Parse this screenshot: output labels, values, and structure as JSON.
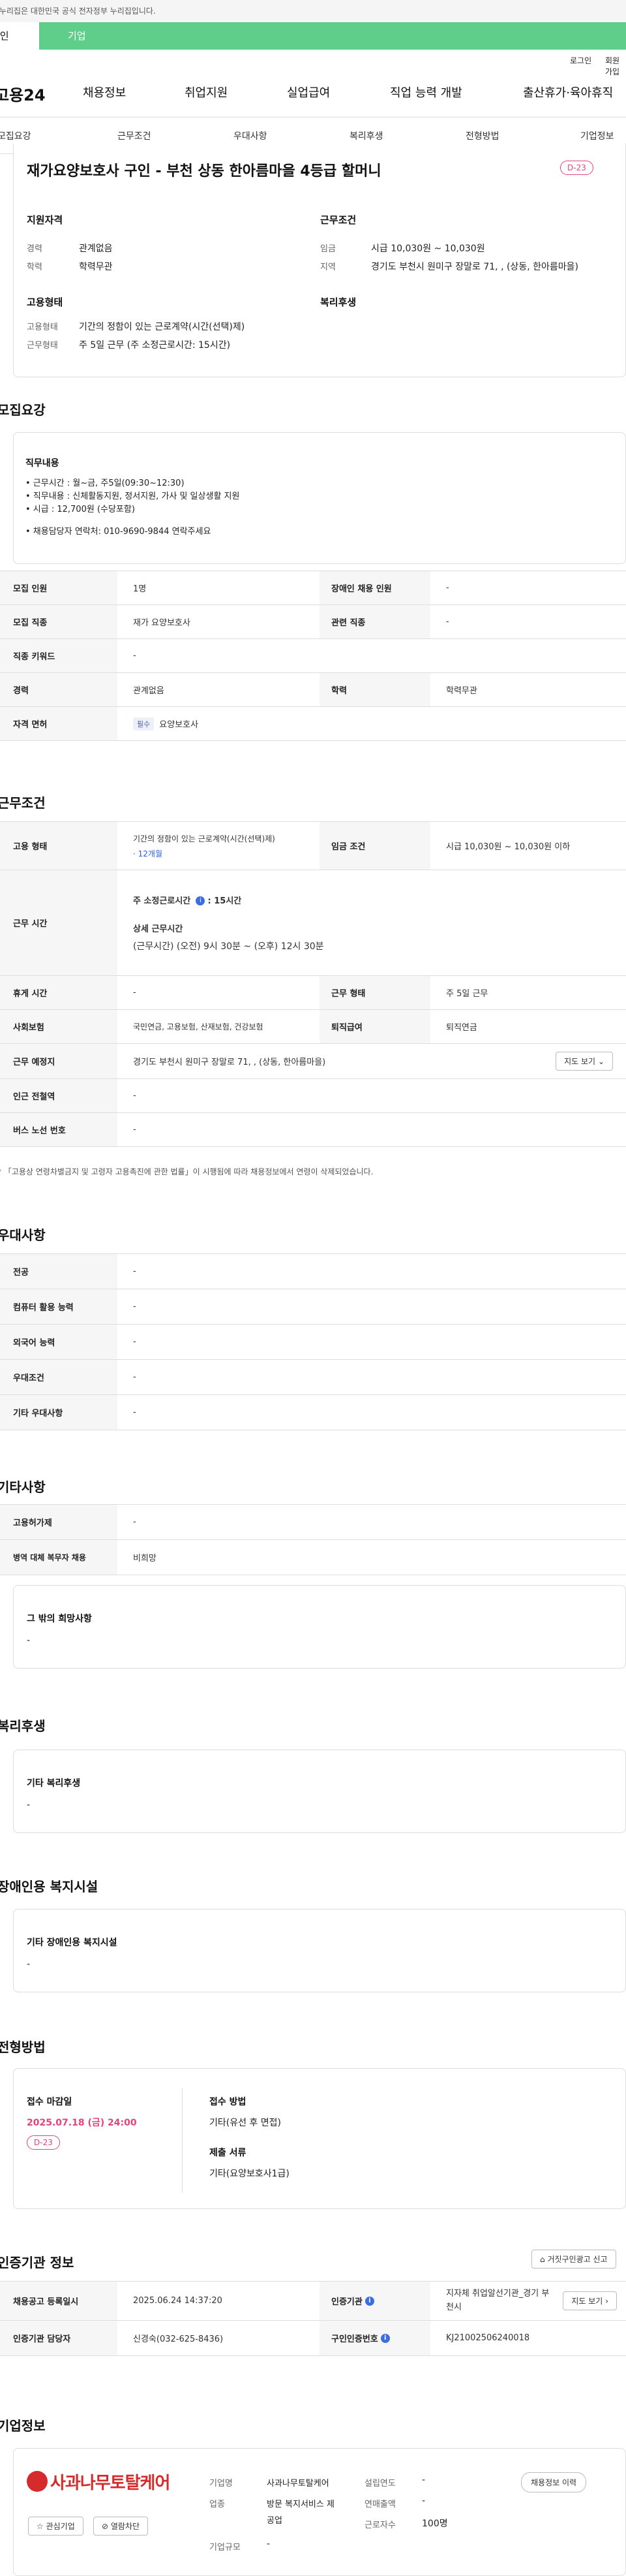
{
  "topbar": {
    "notice": "이 누리집은 대한민국 공식 전자정부 누리집입니다."
  },
  "user_tabs": {
    "individual": "개인",
    "corporate": "기업"
  },
  "util": {
    "login": "로그인",
    "join": "회원가입"
  },
  "gnb": {
    "logo": "고용24",
    "menus": [
      "채용정보",
      "취업지원",
      "실업급여",
      "직업 능력 개발",
      "출산휴가·육아휴직"
    ]
  },
  "lnb": {
    "items": [
      "모집요강",
      "근무조건",
      "우대사항",
      "복리후생",
      "전형방법",
      "기업정보"
    ]
  },
  "job": {
    "title": "재가요양보호사 구인 - 부천 상동 한아름마을 4등급 할머니",
    "dday": "D-23",
    "qual": {
      "heading": "지원자격",
      "career_label": "경력",
      "career": "관계없음",
      "edu_label": "학력",
      "edu": "학력무관"
    },
    "cond": {
      "heading": "근무조건",
      "wage_label": "임금",
      "wage": "시급 10,030원 ~ 10,030원",
      "loc_label": "지역",
      "loc": "경기도 부천시 원미구 장말로 71, , (상동, 한아름마을)"
    },
    "emp": {
      "heading": "고용형태",
      "type_label": "고용형태",
      "type": "기간의 정함이 있는 근로계약(시간(선택)제)",
      "hours_label": "근무형태",
      "hours": "주 5일 근무 (주 소정근로시간: 15시간)"
    },
    "welfare": {
      "heading": "복리후생"
    }
  },
  "recruit": {
    "heading": "모집요강",
    "content_title": "직무내용",
    "content_lines": [
      "• 근무시간 : 월~금, 주5일(09:30~12:30)",
      "• 직무내용 : 신체활동지원, 정서지원, 가사 및 일상생활 지원",
      "• 시급 : 12,700원 (수당포함)",
      "• 채용담당자 연락처: 010-9690-9844 연락주세요"
    ],
    "rows": {
      "count_label": "모집 인원",
      "count": "1명",
      "disabled_label": "장애인 채용 인원",
      "disabled": "-",
      "job_label": "모집 직종",
      "job": "재가 요양보호사",
      "related_label": "관련 직종",
      "related": "-",
      "keyword_label": "직종 키워드",
      "keyword": "-",
      "career_label": "경력",
      "career": "관계없음",
      "edu_label": "학력",
      "edu": "학력무관",
      "license_label": "자격 면허",
      "license_tag": "필수",
      "license": "요양보호사"
    }
  },
  "work": {
    "heading": "근무조건",
    "emp_label": "고용 형태",
    "emp": "기간의 정함이 있는 근로계약(시간(선택)제)",
    "emp_period": "· 12개월",
    "wage_label": "임금 조건",
    "wage": "시급 10,030원 ~ 10,030원 이하",
    "time_label": "근무 시간",
    "time_weekly_title": "주 소정근로시간",
    "time_weekly": ": 15시간",
    "time_detail_title": "상세 근무시간",
    "time_detail": "(근무시간) (오전) 9시 30분 ~ (오후) 12시 30분",
    "break_label": "휴게 시간",
    "break": "-",
    "form_label": "근무 형태",
    "form": "주 5일 근무",
    "ins_label": "사회보험",
    "ins": "국민연금, 고용보험, 산재보험, 건강보험",
    "retire_label": "퇴직급여",
    "retire": "퇴직연금",
    "place_label": "근무 예정지",
    "place": "경기도 부천시 원미구 장말로 71, , (상동, 한아름마을)",
    "map_btn": "지도 보기",
    "subway_label": "인근 전철역",
    "subway": "-",
    "bus_label": "버스 노선 번호",
    "bus": "-",
    "note": "* 「고용상 연령차별금지 및 고령자 고용촉진에 관한 법률」이 시행됨에 따라 채용정보에서 연령이 삭제되었습니다."
  },
  "pref": {
    "heading": "우대사항",
    "major_label": "전공",
    "major": "-",
    "pc_label": "컴퓨터 활용 능력",
    "pc": "-",
    "lang_label": "외국어 능력",
    "lang": "-",
    "cond_label": "우대조건",
    "cond": "-",
    "etc_label": "기타 우대사항",
    "etc": "-"
  },
  "other": {
    "heading": "기타사항",
    "ins_label": "고용허가제",
    "ins": "-",
    "mil_label": "병역 대체 복무자 채용",
    "mil": "비희망",
    "wish_title": "그 밖의 희망사항",
    "wish": "-"
  },
  "welfare": {
    "heading": "복리후생",
    "title": "기타 복리후생",
    "value": "-"
  },
  "disability": {
    "heading": "장애인용 복지시설",
    "title": "기타 장애인용 복지시설",
    "value": "-"
  },
  "screening": {
    "heading": "전형방법",
    "deadline_label": "접수 마감일",
    "deadline": "2025.07.18 (금) 24:00",
    "dday": "D-23",
    "method_label": "접수 방법",
    "method": "기타(유선 후 면접)",
    "docs_label": "제출 서류",
    "docs": "기타(요양보호사1급)"
  },
  "cert": {
    "heading": "인증기관 정보",
    "report_btn": "거짓구인광고 신고",
    "reg_label": "채용공고 등록일시",
    "reg": "2025.06.24 14:37:20",
    "org_label": "인증기관",
    "org": "지자체 취업알선기관_경기 부천시",
    "map_btn": "지도 보기",
    "mgr_label": "인증기관 담당자",
    "mgr": "신경숙(032-625-8436)",
    "no_label": "구인인증번호",
    "no": "KJ21002506240018"
  },
  "company": {
    "heading": "기업정보",
    "logo_text": "사과나무토탈케어",
    "interest_btn": "관심기업",
    "block_btn": "열람차단",
    "name_label": "기업명",
    "name": "사과나무토탈케어",
    "ind_label": "업종",
    "ind": "방문 복지서비스 제공업",
    "size_label": "기업규모",
    "size": "-",
    "year_label": "설립연도",
    "year": "-",
    "sales_label": "연매출액",
    "sales": "-",
    "emp_label": "근로자수",
    "emp": "100명",
    "history_btn": "채용정보 이력"
  },
  "colors": {
    "green": "#5fce8a",
    "accent": "#e0457b",
    "blue": "#2b5fd9"
  }
}
